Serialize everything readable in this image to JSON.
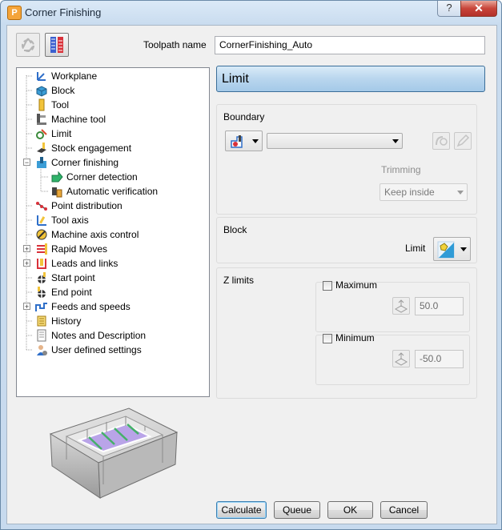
{
  "window": {
    "title": "Corner Finishing",
    "help_label": "?",
    "close_label": "✕"
  },
  "toolpath_name": {
    "label": "Toolpath name",
    "value": "CornerFinishing_Auto"
  },
  "tree": [
    {
      "label": "Workplane",
      "icon": "workplane-icon"
    },
    {
      "label": "Block",
      "icon": "block-icon"
    },
    {
      "label": "Tool",
      "icon": "tool-icon"
    },
    {
      "label": "Machine tool",
      "icon": "machine-tool-icon"
    },
    {
      "label": "Limit",
      "icon": "limit-icon",
      "selected": true
    },
    {
      "label": "Stock engagement",
      "icon": "stock-engagement-icon"
    },
    {
      "label": "Corner finishing",
      "icon": "corner-finishing-icon",
      "expanded": true
    },
    {
      "label": "Corner detection",
      "icon": "corner-detection-icon",
      "child": true
    },
    {
      "label": "Automatic verification",
      "icon": "automatic-verification-icon",
      "child": true
    },
    {
      "label": "Point distribution",
      "icon": "point-distribution-icon"
    },
    {
      "label": "Tool axis",
      "icon": "tool-axis-icon"
    },
    {
      "label": "Machine axis control",
      "icon": "machine-axis-control-icon"
    },
    {
      "label": "Rapid Moves",
      "icon": "rapid-moves-icon",
      "collapsed": true
    },
    {
      "label": "Leads and links",
      "icon": "leads-links-icon",
      "collapsed": true
    },
    {
      "label": "Start point",
      "icon": "start-point-icon"
    },
    {
      "label": "End point",
      "icon": "end-point-icon"
    },
    {
      "label": "Feeds and speeds",
      "icon": "feeds-speeds-icon",
      "collapsed": true
    },
    {
      "label": "History",
      "icon": "history-icon"
    },
    {
      "label": "Notes and Description",
      "icon": "notes-icon"
    },
    {
      "label": "User defined settings",
      "icon": "user-settings-icon"
    }
  ],
  "panel": {
    "title": "Limit",
    "boundary": {
      "label": "Boundary",
      "select_value": "",
      "trimming_label": "Trimming",
      "trimming_value": "Keep inside"
    },
    "block": {
      "label": "Block",
      "limit_label": "Limit"
    },
    "zlimits": {
      "label": "Z limits",
      "maximum_label": "Maximum",
      "maximum_value": "50.0",
      "minimum_label": "Minimum",
      "minimum_value": "-50.0"
    }
  },
  "buttons": {
    "calculate": "Calculate",
    "queue": "Queue",
    "ok": "OK",
    "cancel": "Cancel"
  },
  "colors": {
    "header_bg": "#b9d6ee",
    "selected_region": "#b9a4e8",
    "title_bar": "#c9dcef"
  }
}
